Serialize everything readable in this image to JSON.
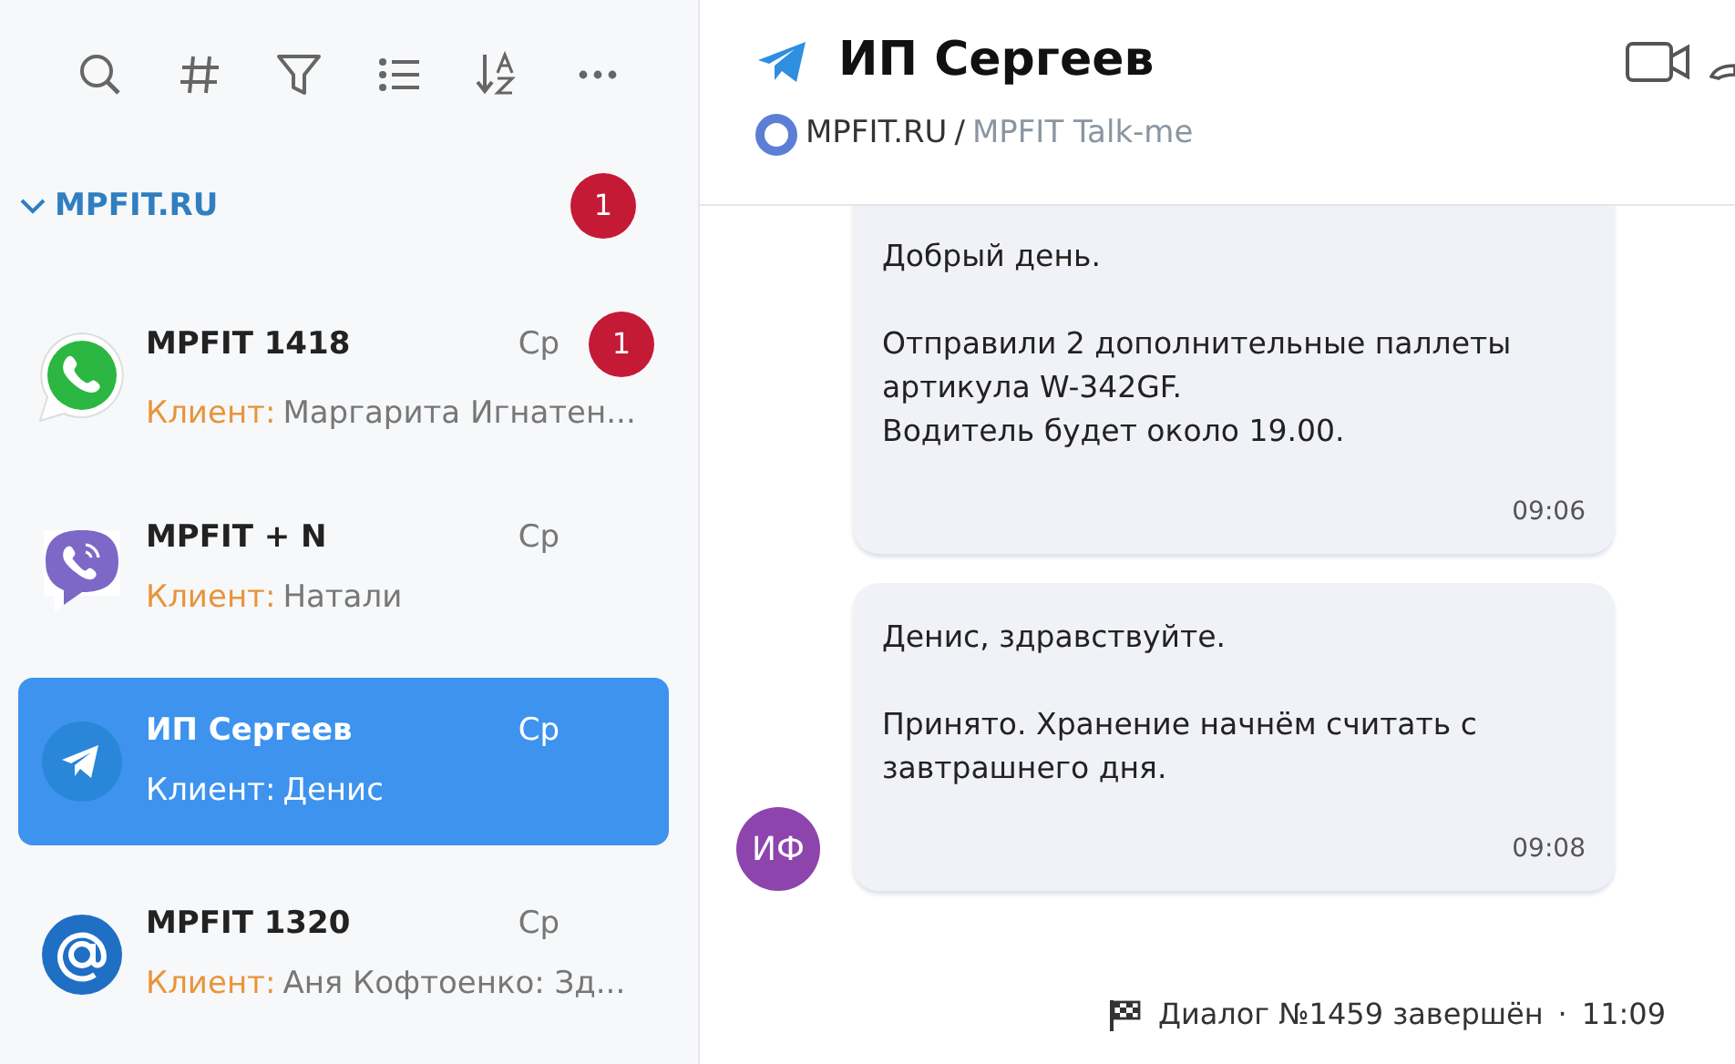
{
  "toolbar": [
    {
      "kind": "search"
    },
    {
      "kind": "hash"
    },
    {
      "kind": "filter"
    },
    {
      "kind": "list"
    },
    {
      "kind": "sort"
    },
    {
      "kind": "more"
    }
  ],
  "group": {
    "title": "MPFIT.RU",
    "expanded": true,
    "badge": "1"
  },
  "chats": [
    {
      "kind": "whatsapp",
      "name": "MPFIT 1418",
      "time": "Ср",
      "badge": "1",
      "sender": "Клиент:",
      "preview": "Маргарита Игнатен...",
      "selected": false
    },
    {
      "kind": "viber",
      "name": "MPFIT + N",
      "time": "Ср",
      "sender": "Клиент:",
      "preview": "Натали",
      "selected": false
    },
    {
      "kind": "telegram",
      "name": "ИП Сергеев",
      "time": "Ср",
      "sender": "Клиент:",
      "preview": "Денис",
      "selected": true
    },
    {
      "kind": "email",
      "name": "MPFIT 1320",
      "time": "Ср",
      "sender": "Клиент:",
      "preview": "Аня Кофтоенко: Зд...",
      "selected": false
    }
  ],
  "header": {
    "title": "ИП Сергеев",
    "source": "MPFIT.RU",
    "separator": "/",
    "channel": "MPFIT Talk-me"
  },
  "messages": [
    {
      "text": "Добрый день.\n\nОтправили 2 дополнительные паллеты артикула W-342GF.\nВодитель будет около 19.00.",
      "time": "09:06"
    },
    {
      "text": "Денис, здравствуйте.\n\nПринято. Хранение начнём считать с завтрашнего дня.",
      "time": "09:08",
      "avatar": "ИФ"
    }
  ],
  "status": {
    "text": "Диалог №1459 завершён",
    "separator": "·",
    "time": "11:09"
  }
}
